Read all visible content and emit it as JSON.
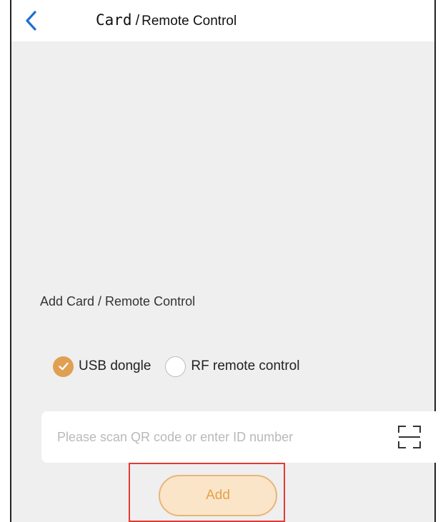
{
  "header": {
    "title_part1": "Card",
    "title_separator": "/",
    "title_part2": "Remote Control",
    "back_icon": "chevron-left-icon"
  },
  "section": {
    "title": "Add Card / Remote Control"
  },
  "device_type": {
    "selected": "USB dongle",
    "options": [
      {
        "label": "USB dongle",
        "checked": true
      },
      {
        "label": "RF remote control",
        "checked": false
      }
    ]
  },
  "id_input": {
    "value": "",
    "placeholder": "Please scan QR code or enter ID number",
    "scan_icon": "scan-icon"
  },
  "actions": {
    "add_label": "Add"
  },
  "colors": {
    "accent": "#e0a052",
    "button_bg": "#fbe5c9",
    "button_text": "#e3a24a",
    "back_blue": "#1f6fd0",
    "highlight_red": "#e23a32",
    "page_bg": "#efefef"
  }
}
